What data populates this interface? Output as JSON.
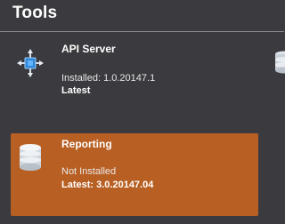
{
  "section_title": "Tools",
  "tools": [
    {
      "name": "API Server",
      "status": "Installed: 1.0.20147.1",
      "latest": "Latest",
      "icon": "api-server-icon"
    },
    {
      "name": "Reporting",
      "status": "Not Installed",
      "latest": "Latest: 3.0.20147.04",
      "icon": "database-icon",
      "highlight_color": "#b85f23"
    }
  ],
  "colors": {
    "background": "#3b3b3f",
    "divider": "#8a8a8e",
    "selected_card": "#b85f23",
    "text": "#ffffff"
  }
}
